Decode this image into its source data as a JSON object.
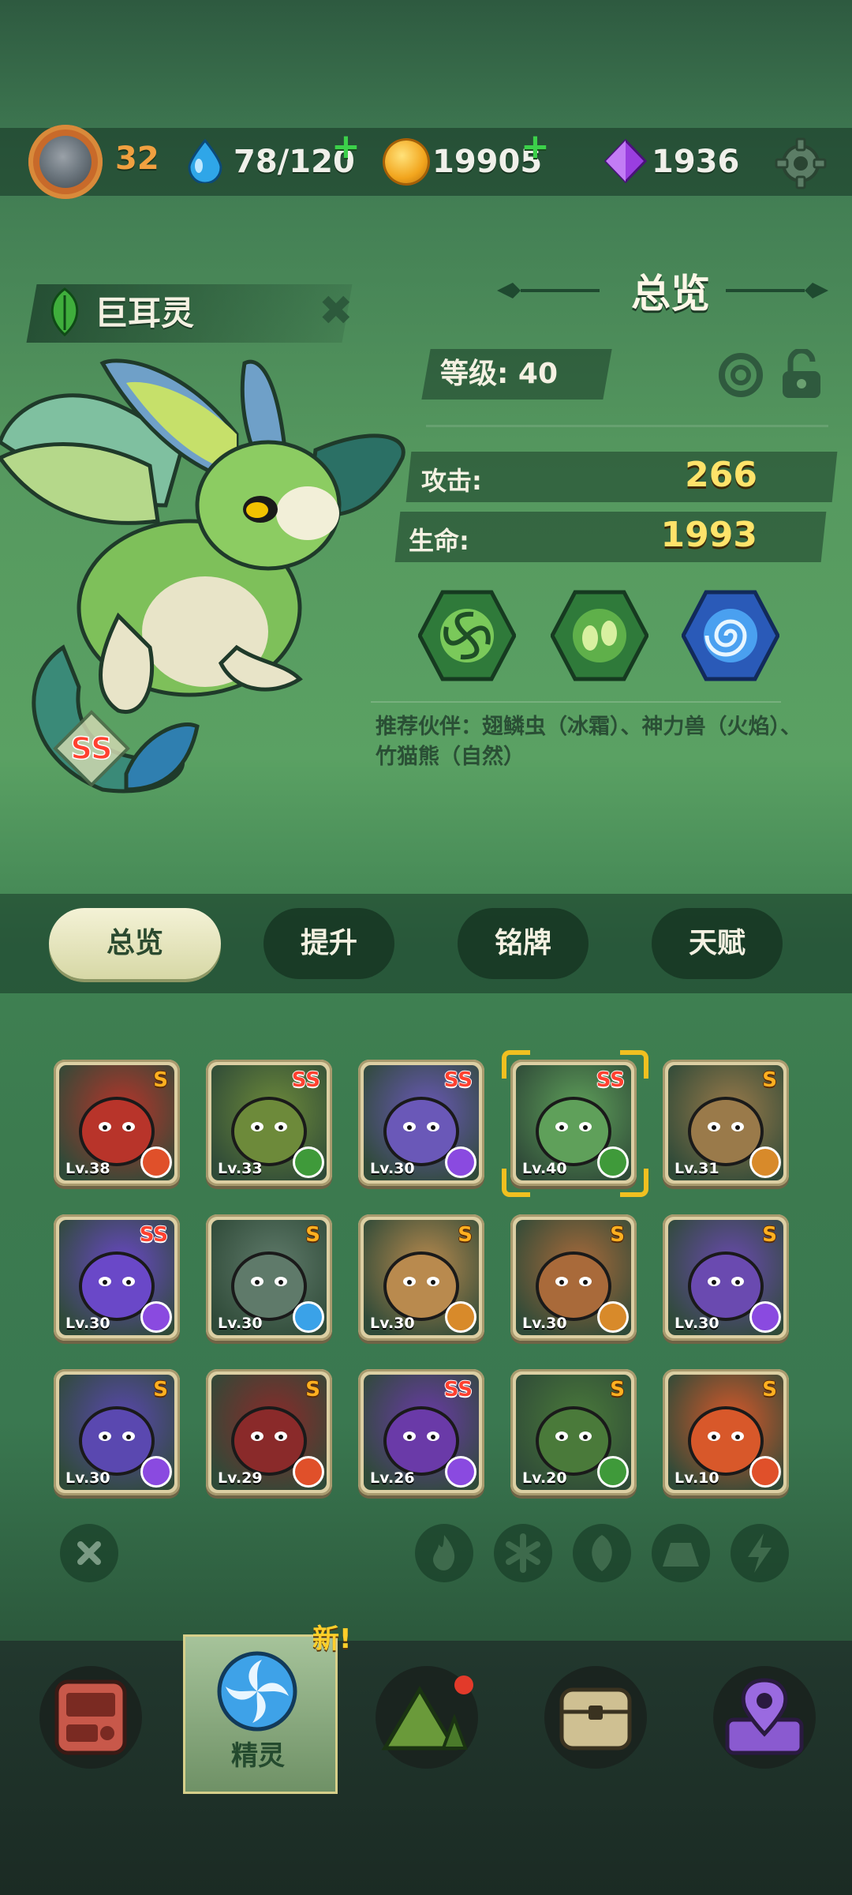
{
  "top": {
    "level": "32",
    "energy": "78/120",
    "coins": "19905",
    "gems": "1936",
    "plus": "+"
  },
  "pet": {
    "name": "巨耳灵",
    "rank": "SS",
    "element": "leaf"
  },
  "overview": {
    "title": "总览",
    "level_label": "等级: 40",
    "attack_label": "攻击:",
    "attack_value": "266",
    "hp_label": "生命:",
    "hp_value": "1993",
    "skills": [
      "wind-skill-icon",
      "seed-skill-icon",
      "vortex-skill-icon"
    ],
    "recommend": "推荐伙伴：翅鳞虫（冰霜）、神力兽（火焰）、竹猫熊（自然）"
  },
  "tabs": [
    "总览",
    "提升",
    "铭牌",
    "天赋"
  ],
  "cards": [
    {
      "lv": "Lv.38",
      "rank": "S",
      "element": "fire",
      "bg": "#b8342a"
    },
    {
      "lv": "Lv.33",
      "rank": "SS",
      "element": "nature",
      "bg": "#6d8a3a"
    },
    {
      "lv": "Lv.30",
      "rank": "SS",
      "element": "lightning",
      "bg": "#6a58b8"
    },
    {
      "lv": "Lv.40",
      "rank": "SS",
      "element": "nature",
      "bg": "#5fa05a"
    },
    {
      "lv": "Lv.31",
      "rank": "S",
      "element": "earth",
      "bg": "#9a7a4a"
    },
    {
      "lv": "Lv.30",
      "rank": "SS",
      "element": "lightning",
      "bg": "#6a48c8"
    },
    {
      "lv": "Lv.30",
      "rank": "S",
      "element": "ice",
      "bg": "#5f7a6a"
    },
    {
      "lv": "Lv.30",
      "rank": "S",
      "element": "earth",
      "bg": "#b98a4e"
    },
    {
      "lv": "Lv.30",
      "rank": "S",
      "element": "earth",
      "bg": "#a96a3a"
    },
    {
      "lv": "Lv.30",
      "rank": "S",
      "element": "lightning",
      "bg": "#6a4ab0"
    },
    {
      "lv": "Lv.30",
      "rank": "S",
      "element": "lightning",
      "bg": "#5a48b0"
    },
    {
      "lv": "Lv.29",
      "rank": "S",
      "element": "fire",
      "bg": "#8a2a2a"
    },
    {
      "lv": "Lv.26",
      "rank": "SS",
      "element": "lightning",
      "bg": "#6a3aa8"
    },
    {
      "lv": "Lv.20",
      "rank": "S",
      "element": "nature",
      "bg": "#4a7a3a"
    },
    {
      "lv": "Lv.10",
      "rank": "S",
      "element": "fire",
      "bg": "#d8582a"
    }
  ],
  "filters": [
    "clear-filter-icon",
    "fire-filter-icon",
    "ice-filter-icon",
    "nature-filter-icon",
    "earth-filter-icon",
    "lightning-filter-icon"
  ],
  "nav": {
    "active_label": "精灵",
    "new_tag": "新!"
  }
}
